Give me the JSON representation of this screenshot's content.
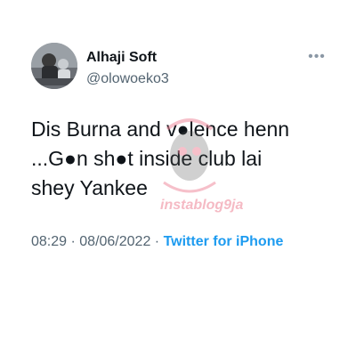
{
  "user": {
    "display_name": "Alhaji Soft",
    "handle": "@olowoeko3",
    "avatar_icon": "user-avatar-photo"
  },
  "tweet": {
    "lines": [
      "Dis Burna and v●lence henn",
      "...G●n sh●t inside club lai",
      "shey Yankee"
    ]
  },
  "meta": {
    "time": "08:29",
    "separator": " · ",
    "date": "08/06/2022",
    "source": "Twitter for iPhone"
  },
  "watermark": {
    "text": "instablog9ja",
    "icon": "owl-logo-icon"
  },
  "menu": {
    "icon": "more-options-icon",
    "glyph": "•••"
  },
  "colors": {
    "text": "#0f1419",
    "secondary": "#536471",
    "link": "#1d9bf0",
    "watermark": "#f3a9b6"
  }
}
